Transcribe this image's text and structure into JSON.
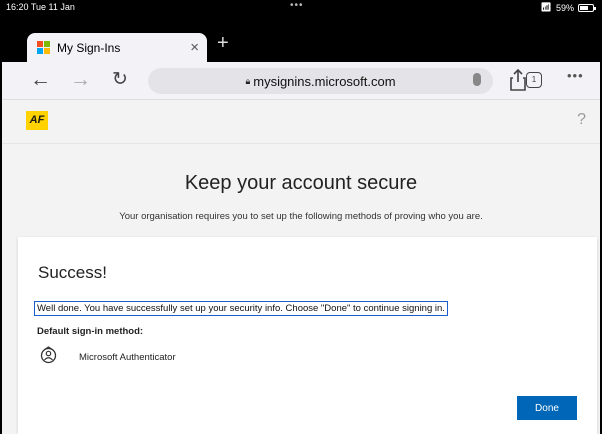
{
  "status_bar": {
    "time": "16:20  Tue 11 Jan",
    "dots": "•••",
    "battery": "59%"
  },
  "tab": {
    "title": "My Sign-Ins",
    "close": "×",
    "new_tab": "+"
  },
  "toolbar": {
    "url": "mysignins.microsoft.com",
    "tab_count": "1",
    "more": "•••"
  },
  "page_header": {
    "logo": "AF",
    "help": "?"
  },
  "page": {
    "heading": "Keep your account secure",
    "subheading": "Your organisation requires you to set up the following methods of proving who you are."
  },
  "card": {
    "title": "Success!",
    "message": "Well done. You have successfully set up your security info. Choose \"Done\" to continue signing in.",
    "default_label": "Default sign-in method:",
    "method": "Microsoft Authenticator",
    "done_label": "Done"
  },
  "colors": {
    "accent": "#0067b8",
    "brand_yellow": "#ffd200",
    "focus_border": "#1a5fd0"
  }
}
